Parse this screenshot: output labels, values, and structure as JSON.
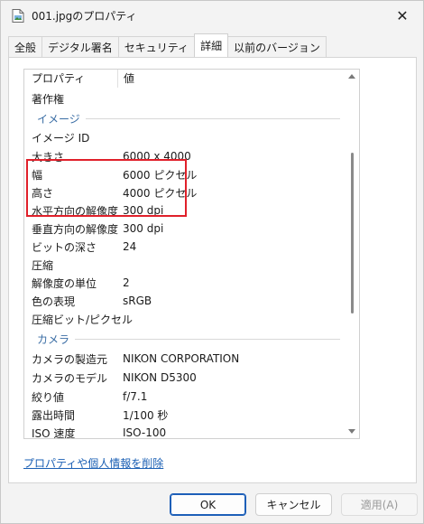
{
  "window": {
    "title": "001.jpgのプロパティ",
    "close_icon": "close-icon",
    "file_icon": "image-file-icon"
  },
  "tabs": [
    {
      "label": "全般",
      "active": false
    },
    {
      "label": "デジタル署名",
      "active": false
    },
    {
      "label": "セキュリティ",
      "active": false
    },
    {
      "label": "詳細",
      "active": true
    },
    {
      "label": "以前のバージョン",
      "active": false
    }
  ],
  "details": {
    "header": {
      "name": "プロパティ",
      "value": "値"
    },
    "rows_top": [
      {
        "name": "著作権",
        "value": ""
      }
    ],
    "group_image": "イメージ",
    "rows_image": [
      {
        "name": "イメージ ID",
        "value": ""
      },
      {
        "name": "大きさ",
        "value": "6000 x 4000"
      },
      {
        "name": "幅",
        "value": "6000 ピクセル"
      },
      {
        "name": "高さ",
        "value": "4000 ピクセル"
      },
      {
        "name": "水平方向の解像度",
        "value": "300 dpi"
      },
      {
        "name": "垂直方向の解像度",
        "value": "300 dpi"
      },
      {
        "name": "ビットの深さ",
        "value": "24"
      },
      {
        "name": "圧縮",
        "value": ""
      },
      {
        "name": "解像度の単位",
        "value": "2"
      },
      {
        "name": "色の表現",
        "value": "sRGB"
      },
      {
        "name": "圧縮ビット/ピクセル",
        "value": ""
      }
    ],
    "group_camera": "カメラ",
    "rows_camera": [
      {
        "name": "カメラの製造元",
        "value": "NIKON CORPORATION"
      },
      {
        "name": "カメラのモデル",
        "value": "NIKON D5300"
      },
      {
        "name": "絞り値",
        "value": "f/7.1"
      },
      {
        "name": "露出時間",
        "value": "1/100 秒"
      },
      {
        "name": "ISO 速度",
        "value": "ISO-100"
      }
    ],
    "highlight_color": "#e0202a"
  },
  "remove_link": "プロパティや個人情報を削除",
  "buttons": {
    "ok": "OK",
    "cancel": "キャンセル",
    "apply": "適用(A)"
  }
}
